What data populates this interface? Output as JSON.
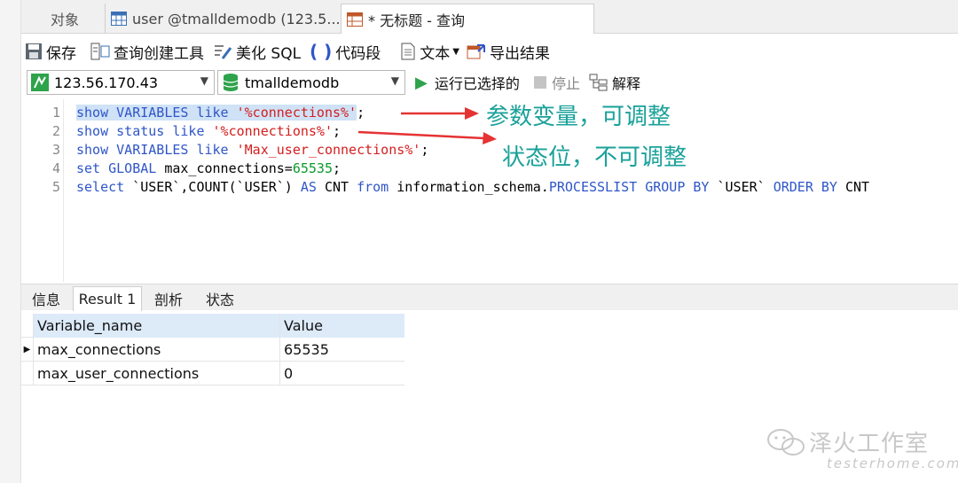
{
  "tabs": {
    "objects": "对象",
    "user_tab": "user @tmalldemodb (123.5...",
    "query_tab": "* 无标题 - 查询"
  },
  "toolbar": {
    "save": "保存",
    "query_builder": "查询创建工具",
    "beautify": "美化 SQL",
    "snippet": "代码段",
    "text": "文本",
    "export": "导出结果"
  },
  "connection": {
    "host": "123.56.170.43",
    "database": "tmalldemodb",
    "run_selected": "运行已选择的",
    "stop": "停止",
    "explain": "解释"
  },
  "editor": {
    "line_numbers": [
      "1",
      "2",
      "3",
      "4",
      "5"
    ],
    "lines": [
      [
        "show",
        " ",
        "VARIABLES",
        " ",
        "like",
        " ",
        "'%connections%'",
        ";"
      ],
      [
        "show",
        " ",
        "status",
        " ",
        "like",
        " ",
        "'%connections%'",
        ";"
      ],
      [
        "show",
        " ",
        "VARIABLES",
        " ",
        "like",
        " ",
        "'Max_user_connections%'",
        ";"
      ],
      [
        "set",
        " ",
        "GLOBAL",
        " max_connections=",
        "65535",
        ";"
      ],
      [
        "select",
        " `USER`,COUNT(`USER`) ",
        "AS",
        " CNT ",
        "from",
        " information_schema.",
        "PROCESSLIST",
        " ",
        "GROUP",
        " ",
        "BY",
        " `USER` ",
        "ORDER",
        " ",
        "BY",
        " CNT"
      ]
    ]
  },
  "annotations": {
    "params_adjustable": "参数变量，可调整",
    "status_fixed": "状态位，不可调整"
  },
  "result_tabs": [
    "信息",
    "Result 1",
    "剖析",
    "状态"
  ],
  "result_grid": {
    "columns": [
      "Variable_name",
      "Value"
    ],
    "rows": [
      [
        "max_connections",
        "65535"
      ],
      [
        "max_user_connections",
        "0"
      ]
    ]
  },
  "watermark": {
    "name": "泽火工作室",
    "site": "testerhome.com"
  }
}
